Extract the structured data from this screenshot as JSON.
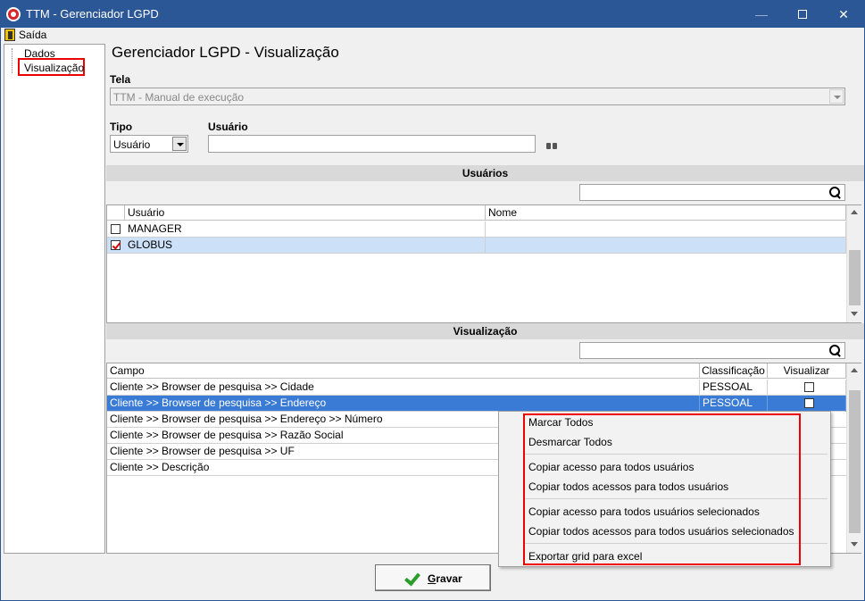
{
  "window": {
    "title": "TTM - Gerenciador LGPD",
    "minimize": "—",
    "close": "✕"
  },
  "menu": {
    "exit_label": "Saída"
  },
  "tree": {
    "items": [
      "Dados",
      "Visualização"
    ]
  },
  "main": {
    "page_title": "Gerenciador LGPD - Visualização",
    "tela_label": "Tela",
    "tela_value": "TTM - Manual de execução",
    "tipo_label": "Tipo",
    "tipo_value": "Usuário",
    "usuario_label": "Usuário",
    "usuario_value": ""
  },
  "users_section": {
    "header": "Usuários",
    "columns": [
      "Usuário",
      "Nome"
    ],
    "rows": [
      {
        "usuario": "MANAGER",
        "nome": "",
        "checked": false
      },
      {
        "usuario": "GLOBUS",
        "nome": "",
        "checked": true
      }
    ]
  },
  "vis_section": {
    "header": "Visualização",
    "columns": [
      "Campo",
      "Classificação",
      "Visualizar"
    ],
    "rows": [
      {
        "campo": "Cliente >> Browser de pesquisa >> Cidade",
        "classificacao": "PESSOAL"
      },
      {
        "campo": "Cliente >> Browser de pesquisa >> Endereço",
        "classificacao": "PESSOAL"
      },
      {
        "campo": "Cliente >> Browser de pesquisa >> Endereço >> Número",
        "classificacao": ""
      },
      {
        "campo": "Cliente >> Browser de pesquisa >> Razão Social",
        "classificacao": ""
      },
      {
        "campo": "Cliente >> Browser de pesquisa >> UF",
        "classificacao": ""
      },
      {
        "campo": "Cliente >> Descrição",
        "classificacao": ""
      }
    ]
  },
  "context_menu": {
    "items": [
      "Marcar Todos",
      "Desmarcar Todos",
      "Copiar acesso para todos usuários",
      "Copiar todos acessos para todos usuários",
      "Copiar acesso para todos usuários selecionados",
      "Copiar todos acessos para todos usuários selecionados",
      "Exportar grid para excel"
    ]
  },
  "buttons": {
    "save_label": "Gravar"
  },
  "colors": {
    "titlebar": "#2b5797",
    "selection": "#3a7bd5",
    "highlight_border": "#e00000"
  }
}
